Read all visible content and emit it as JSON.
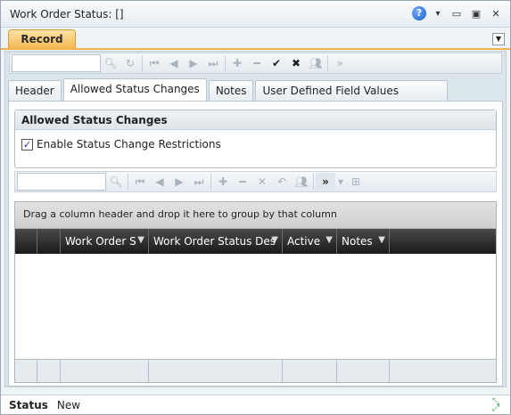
{
  "window": {
    "title": "Work Order Status: []"
  },
  "record_tab": {
    "label": "Record"
  },
  "tabs": [
    {
      "label": "Header"
    },
    {
      "label": "Allowed Status Changes"
    },
    {
      "label": "Notes"
    },
    {
      "label": "User Defined Field Values"
    }
  ],
  "group": {
    "title": "Allowed Status Changes",
    "checkbox_label": "Enable Status Change Restrictions",
    "checked": true
  },
  "grid": {
    "group_hint": "Drag a column header and drop it here to group by that column",
    "columns": [
      "Work Order S",
      "Work Order Status Des",
      "Active",
      "Notes"
    ]
  },
  "status": {
    "label": "Status",
    "value": "New"
  },
  "icons": {
    "help": "help-icon",
    "menu": "dropdown-arrow-icon",
    "minimize": "minimize-icon",
    "restore": "restore-icon",
    "close": "close-icon"
  },
  "colors": {
    "record_tab": "#f4b650",
    "grid_header": "#1a1a1a",
    "help": "#1f5fc7"
  }
}
